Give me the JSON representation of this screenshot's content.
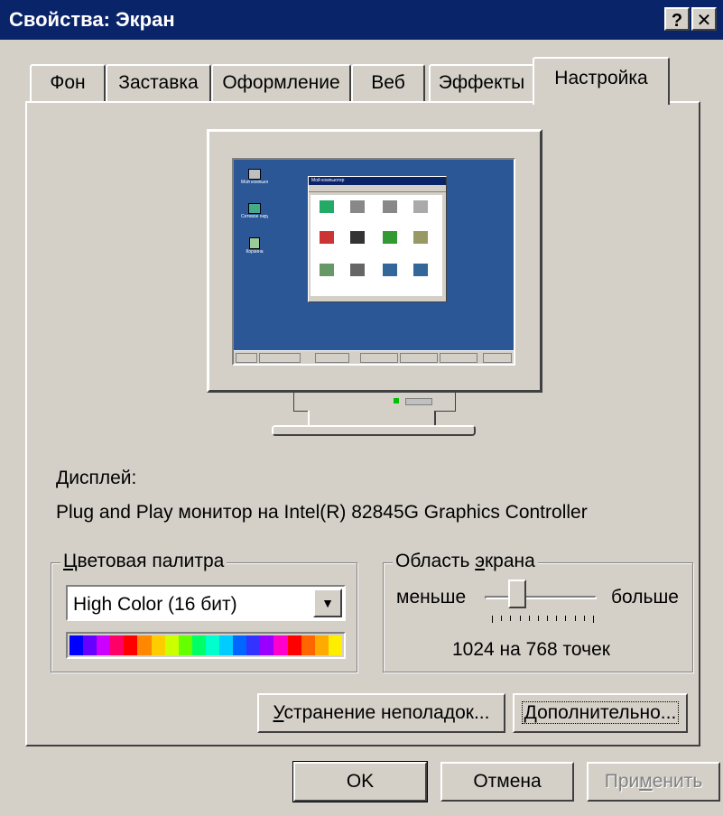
{
  "window": {
    "title": "Свойства: Экран",
    "help_glyph": "?",
    "close_glyph": "✕"
  },
  "tabs": [
    {
      "label": "Фон"
    },
    {
      "label": "Заставка"
    },
    {
      "label": "Оформление"
    },
    {
      "label": "Веб"
    },
    {
      "label": "Эффекты"
    },
    {
      "label": "Настройка"
    }
  ],
  "display": {
    "label": "Дисплей:",
    "device": "Plug and Play монитор на Intel(R) 82845G Graphics Controller"
  },
  "color_palette": {
    "legend_letter": "Ц",
    "legend_rest": "ветовая палитра",
    "selected": "High Color (16 бит)",
    "arrow_glyph": "▼",
    "spectrum_colors": [
      "#0000ff",
      "#6600ff",
      "#cc00ff",
      "#ff0066",
      "#ff0000",
      "#ff8800",
      "#ffcc00",
      "#ccff00",
      "#66ff00",
      "#00ff66",
      "#00ffcc",
      "#00ccff",
      "#0066ff",
      "#3333ff",
      "#9900ff",
      "#ff00cc",
      "#ff0000",
      "#ff6600",
      "#ffaa00",
      "#ffee00"
    ]
  },
  "screen_area": {
    "legend_pre": "Область ",
    "legend_letter": "э",
    "legend_rest": "крана",
    "less": "меньше",
    "more": "больше",
    "resolution": "1024 на 768 точек",
    "slider_position": 0.25
  },
  "buttons": {
    "troubleshoot_letter": "У",
    "troubleshoot_rest": "странение неполадок...",
    "advanced_letter": "Д",
    "advanced_rest": "ополнительно...",
    "ok": "OK",
    "cancel": "Отмена",
    "apply_pre": "При",
    "apply_letter": "м",
    "apply_rest": "енить"
  },
  "preview": {
    "desktop_icons": [
      "Мой компьютер",
      "Сетевое окружение",
      "Корзина"
    ],
    "window_title": "Мой компьютер",
    "colors": {
      "desktop": "#2b5797",
      "bezel": "#d4d0c8",
      "titlebar": "#0a246a"
    }
  }
}
